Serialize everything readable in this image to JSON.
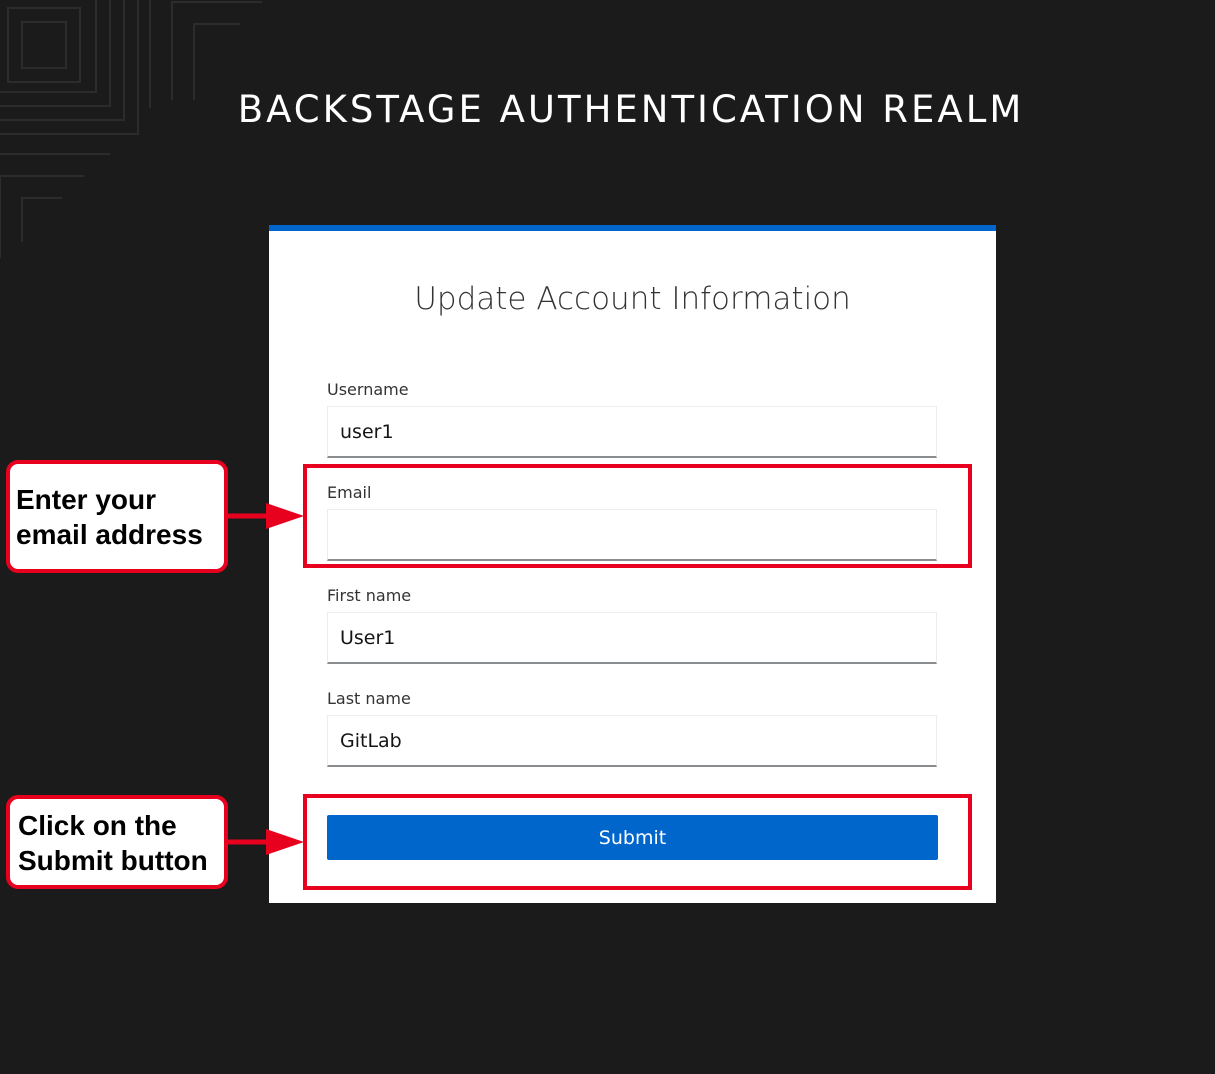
{
  "realm": {
    "title": "BACKSTAGE AUTHENTICATION REALM"
  },
  "form": {
    "title": "Update Account Information",
    "fields": [
      {
        "label": "Username",
        "value": "user1"
      },
      {
        "label": "Email",
        "value": ""
      },
      {
        "label": "First name",
        "value": "User1"
      },
      {
        "label": "Last name",
        "value": "GitLab"
      }
    ],
    "submit_label": "Submit"
  },
  "annotations": {
    "email_callout": [
      "Enter your",
      "email address"
    ],
    "submit_callout": [
      "Click on the",
      "Submit button"
    ]
  },
  "colors": {
    "background": "#1b1b1b",
    "accent": "#0066cc",
    "highlight": "#e8001f"
  }
}
